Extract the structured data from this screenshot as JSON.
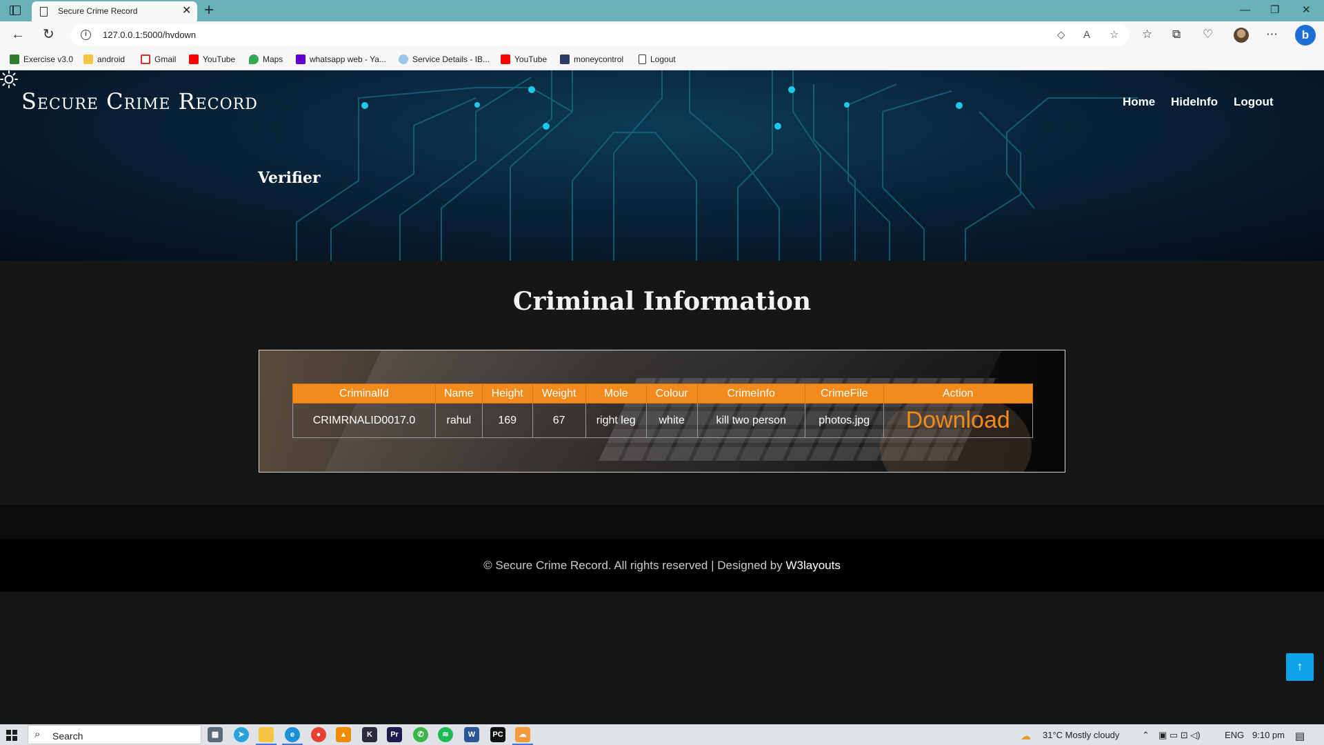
{
  "browser": {
    "tab_title": "Secure Crime Record",
    "url": "127.0.0.1:5000/hvdown",
    "bookmarks": [
      {
        "label": "Exercise v3.0",
        "icon": "w-icon",
        "color": "#2e7d32"
      },
      {
        "label": "android",
        "icon": "folder-icon",
        "color": "#f4c542"
      },
      {
        "label": "Gmail",
        "icon": "gmail-icon",
        "color": "#d93025"
      },
      {
        "label": "YouTube",
        "icon": "youtube-icon",
        "color": "#ff0000"
      },
      {
        "label": "Maps",
        "icon": "maps-pin-icon",
        "color": "#34a853"
      },
      {
        "label": "whatsapp web - Ya...",
        "icon": "yahoo-icon",
        "color": "#6001d2"
      },
      {
        "label": "Service Details - IB...",
        "icon": "cloud-icon",
        "color": "#9ec5ea"
      },
      {
        "label": "YouTube",
        "icon": "youtube-icon",
        "color": "#ff0000"
      },
      {
        "label": "moneycontrol",
        "icon": "moneycontrol-icon",
        "color": "#2b3a67"
      },
      {
        "label": "Logout",
        "icon": "page-icon",
        "color": "#ffffff"
      }
    ]
  },
  "site": {
    "brand": "Secure Crime Record",
    "nav": {
      "home": "Home",
      "hideinfo": "HideInfo",
      "logout": "Logout"
    },
    "hero_heading": "Verifier",
    "section_title": "Criminal Information",
    "accent_color": "#f28b1c"
  },
  "table": {
    "headers": [
      "CriminalId",
      "Name",
      "Height",
      "Weight",
      "Mole",
      "Colour",
      "CrimeInfo",
      "CrimeFile",
      "Action"
    ],
    "rows": [
      {
        "criminal_id": "CRIMRNALID0017.0",
        "name": "rahul",
        "height": "169",
        "weight": "67",
        "mole": "right leg",
        "colour": "white",
        "crime_info": "kill two person",
        "crime_file": "photos.jpg",
        "action": "Download"
      }
    ]
  },
  "footer": {
    "text": "© Secure Crime Record. All rights reserved | Designed by",
    "link": "W3layouts"
  },
  "taskbar": {
    "search_placeholder": "Search",
    "weather": "31°C  Mostly cloudy",
    "language": "ENG",
    "time": "9:10 pm"
  }
}
